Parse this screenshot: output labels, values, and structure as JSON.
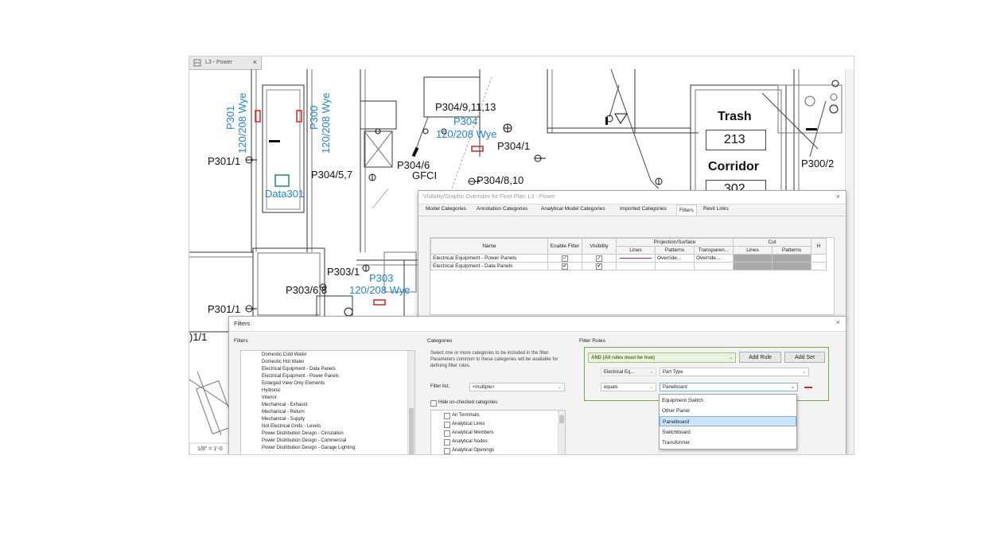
{
  "view_tab": {
    "title": "L3 - Power",
    "close": "×"
  },
  "plan": {
    "labels": {
      "p301_vert": "P301",
      "p301_volt_vert": "120/208 Wye",
      "p300_vert": "P300",
      "p300_volt_vert": "120/208 Wye",
      "p301_1_a": "P301/1",
      "data301": "Data301",
      "p304_5_7": "P304/5,7",
      "p304_6": "P304/6",
      "gfci": "GFCI",
      "p304_9": "P304/9,11,13",
      "p304": "P304",
      "p304_volt": "120/208 Wye",
      "p304_1": "P304/1",
      "p304_8": "P304/8,10",
      "trash": "Trash",
      "room_213": "213",
      "corridor": "Corridor",
      "room_302": "302",
      "p300_2": "P300/2",
      "p303_1": "P303/1",
      "p303": "P303",
      "p303_volt": "120/208 Wye",
      "p303_6_8": "P303/6,8",
      "p301_1_b": "P301/1",
      "frag_01_1": ")1/1",
      "scale": "1/8\" = 1'-0"
    }
  },
  "vg_dialog": {
    "title": "Visibility/Graphic Overrides for Floor Plan: L3 - Power",
    "close": "×",
    "tabs": [
      "Model Categories",
      "Annotation Categories",
      "Analytical Model Categories",
      "Imported Categories",
      "Filters",
      "Revit Links"
    ],
    "active_tab": "Filters",
    "headers": {
      "name": "Name",
      "enable_filter": "Enable Filter",
      "visibility": "Visibility",
      "projection_surface": "Projection/Surface",
      "cut": "Cut",
      "lines": "Lines",
      "patterns": "Patterns",
      "transparency": "Transparen...",
      "cut_lines": "Lines",
      "cut_patterns": "Patterns",
      "halftone_partial": "H"
    },
    "rows": [
      {
        "name": "Electrical Equipment - Power Panels",
        "enable": true,
        "visible": true,
        "patterns": "Override...",
        "transparency": "Override..."
      },
      {
        "name": "Electrical Equipment - Data Panels",
        "enable": true,
        "visible": true,
        "patterns": "",
        "transparency": ""
      }
    ]
  },
  "filters_dialog": {
    "title": "Filters",
    "close": "×",
    "filters_heading": "Filters",
    "filters": [
      "Domestic Cold Water",
      "Domestic Hot Water",
      "Electrical Equipment - Data Panels",
      "Electrical Equipment - Power Panels",
      "Enlarged View Only Elements",
      "Hydronic",
      "Interior",
      "Mechanical - Exhaust",
      "Mechanical - Return",
      "Mechanical - Supply",
      "Not Electrical Grids - Levels",
      "Power Distribution Design - Circulation",
      "Power Distribution Design - Commercial",
      "Power Distribution Design - Garage Lighting"
    ],
    "categories_heading": "Categories",
    "categories_help": "Select one or more categories to be included in the filter.  Parameters common to these categories will be available for defining filter rules.",
    "filter_list_label": "Filter list:",
    "filter_list_value": "<multiple>",
    "hide_unchecked_label": "Hide un-checked categories",
    "categories": [
      "Air Terminals",
      "Analytical Links",
      "Analytical Members",
      "Analytical Nodes",
      "Analytical Openings"
    ],
    "rules_heading": "Filter Rules",
    "rule_group": "AND (All rules must be true)",
    "add_rule": "Add Rule",
    "add_set": "Add Set",
    "rule_category": "Electrical Eq...",
    "rule_parameter": "Part Type",
    "rule_operator": "equals",
    "rule_value": "Panelboard",
    "dropdown_options": [
      "Equipment Switch",
      "Other Panel",
      "Panelboard",
      "Switchboard",
      "Transformer"
    ],
    "dropdown_selected": "Panelboard"
  },
  "colors": {
    "accent_blue": "#1a86d8",
    "rule_green": "#6fae3a",
    "red_marker": "#e0201d"
  }
}
